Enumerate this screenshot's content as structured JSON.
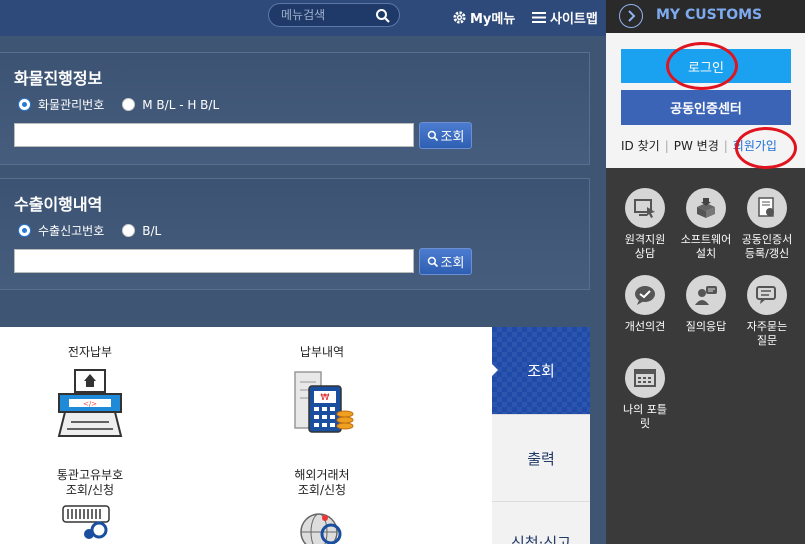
{
  "header": {
    "search_placeholder": "메뉴검색",
    "mymenu_label": "My메뉴",
    "sitemap_label": "사이트맵"
  },
  "cargo": {
    "title": "화물진행정보",
    "radio1": "화물관리번호",
    "radio2": "M B/L - H B/L",
    "query_label": "조회"
  },
  "export": {
    "title": "수출이행내역",
    "radio1": "수출신고번호",
    "radio2": "B/L",
    "query_label": "조회"
  },
  "services": [
    {
      "line1": "전자납부",
      "line2": ""
    },
    {
      "line1": "납부내역",
      "line2": ""
    },
    {
      "line1": "통관고유부호",
      "line2": "조회/신청"
    },
    {
      "line1": "해외거래처",
      "line2": "조회/신청"
    }
  ],
  "tabs": {
    "active": "조회",
    "second": "출력",
    "third": "신청·신고"
  },
  "sidebar": {
    "title": "MY CUSTOMS",
    "login_label": "로그인",
    "cert_label": "공동인증센터",
    "find_id": "ID 찾기",
    "change_pw": "PW 변경",
    "join": "회원가입",
    "items": [
      {
        "line1": "원격지원",
        "line2": "상담"
      },
      {
        "line1": "소프트웨어",
        "line2": "설치"
      },
      {
        "line1": "공동인증서",
        "line2": "등록/갱신"
      },
      {
        "line1": "개선의견",
        "line2": ""
      },
      {
        "line1": "질의응답",
        "line2": ""
      },
      {
        "line1": "자주묻는",
        "line2": "질문"
      },
      {
        "line1": "나의 포틀",
        "line2": "릿"
      }
    ]
  },
  "colors": {
    "login": "#1aa2f0",
    "cert": "#3b63b6",
    "accent_blue": "#1f4aa8",
    "annotation_red": "#e0141e"
  }
}
